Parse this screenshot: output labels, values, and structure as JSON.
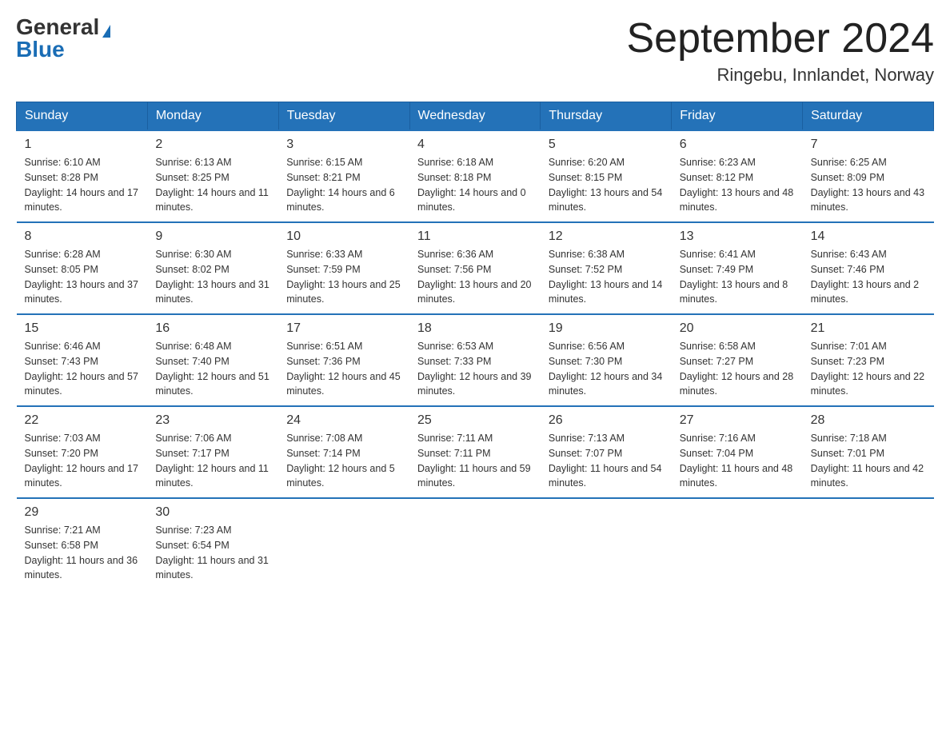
{
  "logo": {
    "general": "General",
    "blue": "Blue"
  },
  "title": "September 2024",
  "location": "Ringebu, Innlandet, Norway",
  "days_of_week": [
    "Sunday",
    "Monday",
    "Tuesday",
    "Wednesday",
    "Thursday",
    "Friday",
    "Saturday"
  ],
  "weeks": [
    [
      {
        "day": "1",
        "sunrise": "6:10 AM",
        "sunset": "8:28 PM",
        "daylight": "14 hours and 17 minutes."
      },
      {
        "day": "2",
        "sunrise": "6:13 AM",
        "sunset": "8:25 PM",
        "daylight": "14 hours and 11 minutes."
      },
      {
        "day": "3",
        "sunrise": "6:15 AM",
        "sunset": "8:21 PM",
        "daylight": "14 hours and 6 minutes."
      },
      {
        "day": "4",
        "sunrise": "6:18 AM",
        "sunset": "8:18 PM",
        "daylight": "14 hours and 0 minutes."
      },
      {
        "day": "5",
        "sunrise": "6:20 AM",
        "sunset": "8:15 PM",
        "daylight": "13 hours and 54 minutes."
      },
      {
        "day": "6",
        "sunrise": "6:23 AM",
        "sunset": "8:12 PM",
        "daylight": "13 hours and 48 minutes."
      },
      {
        "day": "7",
        "sunrise": "6:25 AM",
        "sunset": "8:09 PM",
        "daylight": "13 hours and 43 minutes."
      }
    ],
    [
      {
        "day": "8",
        "sunrise": "6:28 AM",
        "sunset": "8:05 PM",
        "daylight": "13 hours and 37 minutes."
      },
      {
        "day": "9",
        "sunrise": "6:30 AM",
        "sunset": "8:02 PM",
        "daylight": "13 hours and 31 minutes."
      },
      {
        "day": "10",
        "sunrise": "6:33 AM",
        "sunset": "7:59 PM",
        "daylight": "13 hours and 25 minutes."
      },
      {
        "day": "11",
        "sunrise": "6:36 AM",
        "sunset": "7:56 PM",
        "daylight": "13 hours and 20 minutes."
      },
      {
        "day": "12",
        "sunrise": "6:38 AM",
        "sunset": "7:52 PM",
        "daylight": "13 hours and 14 minutes."
      },
      {
        "day": "13",
        "sunrise": "6:41 AM",
        "sunset": "7:49 PM",
        "daylight": "13 hours and 8 minutes."
      },
      {
        "day": "14",
        "sunrise": "6:43 AM",
        "sunset": "7:46 PM",
        "daylight": "13 hours and 2 minutes."
      }
    ],
    [
      {
        "day": "15",
        "sunrise": "6:46 AM",
        "sunset": "7:43 PM",
        "daylight": "12 hours and 57 minutes."
      },
      {
        "day": "16",
        "sunrise": "6:48 AM",
        "sunset": "7:40 PM",
        "daylight": "12 hours and 51 minutes."
      },
      {
        "day": "17",
        "sunrise": "6:51 AM",
        "sunset": "7:36 PM",
        "daylight": "12 hours and 45 minutes."
      },
      {
        "day": "18",
        "sunrise": "6:53 AM",
        "sunset": "7:33 PM",
        "daylight": "12 hours and 39 minutes."
      },
      {
        "day": "19",
        "sunrise": "6:56 AM",
        "sunset": "7:30 PM",
        "daylight": "12 hours and 34 minutes."
      },
      {
        "day": "20",
        "sunrise": "6:58 AM",
        "sunset": "7:27 PM",
        "daylight": "12 hours and 28 minutes."
      },
      {
        "day": "21",
        "sunrise": "7:01 AM",
        "sunset": "7:23 PM",
        "daylight": "12 hours and 22 minutes."
      }
    ],
    [
      {
        "day": "22",
        "sunrise": "7:03 AM",
        "sunset": "7:20 PM",
        "daylight": "12 hours and 17 minutes."
      },
      {
        "day": "23",
        "sunrise": "7:06 AM",
        "sunset": "7:17 PM",
        "daylight": "12 hours and 11 minutes."
      },
      {
        "day": "24",
        "sunrise": "7:08 AM",
        "sunset": "7:14 PM",
        "daylight": "12 hours and 5 minutes."
      },
      {
        "day": "25",
        "sunrise": "7:11 AM",
        "sunset": "7:11 PM",
        "daylight": "11 hours and 59 minutes."
      },
      {
        "day": "26",
        "sunrise": "7:13 AM",
        "sunset": "7:07 PM",
        "daylight": "11 hours and 54 minutes."
      },
      {
        "day": "27",
        "sunrise": "7:16 AM",
        "sunset": "7:04 PM",
        "daylight": "11 hours and 48 minutes."
      },
      {
        "day": "28",
        "sunrise": "7:18 AM",
        "sunset": "7:01 PM",
        "daylight": "11 hours and 42 minutes."
      }
    ],
    [
      {
        "day": "29",
        "sunrise": "7:21 AM",
        "sunset": "6:58 PM",
        "daylight": "11 hours and 36 minutes."
      },
      {
        "day": "30",
        "sunrise": "7:23 AM",
        "sunset": "6:54 PM",
        "daylight": "11 hours and 31 minutes."
      },
      null,
      null,
      null,
      null,
      null
    ]
  ]
}
